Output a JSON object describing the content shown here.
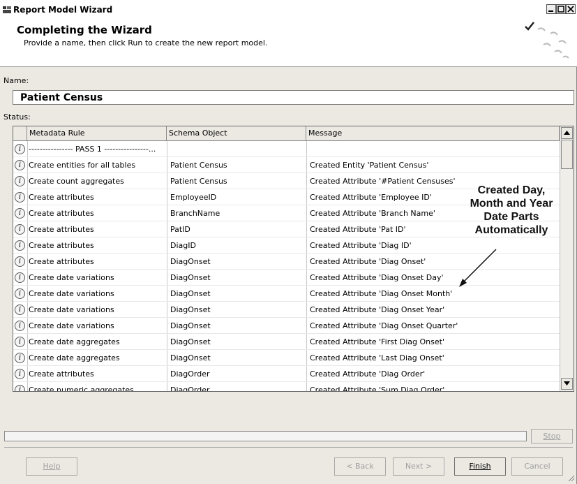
{
  "window": {
    "title": "Report Model Wizard"
  },
  "header": {
    "title": "Completing the Wizard",
    "subtitle": "Provide a name, then click Run to create the new report model."
  },
  "name": {
    "label": "Name:",
    "value": "Patient Census"
  },
  "status": {
    "label": "Status:"
  },
  "grid": {
    "columns": [
      "Metadata Rule",
      "Schema Object",
      "Message"
    ],
    "rows": [
      {
        "rule": "---------------- PASS 1 ----------------...",
        "object": "",
        "message": ""
      },
      {
        "rule": "Create entities for all tables",
        "object": "Patient Census",
        "message": "Created Entity 'Patient Census'"
      },
      {
        "rule": "Create count aggregates",
        "object": "Patient Census",
        "message": "Created Attribute '#Patient Censuses'"
      },
      {
        "rule": "Create attributes",
        "object": "EmployeeID",
        "message": "Created Attribute 'Employee ID'"
      },
      {
        "rule": "Create attributes",
        "object": "BranchName",
        "message": "Created Attribute 'Branch Name'"
      },
      {
        "rule": "Create attributes",
        "object": "PatID",
        "message": "Created Attribute 'Pat ID'"
      },
      {
        "rule": "Create attributes",
        "object": "DiagID",
        "message": "Created Attribute 'Diag ID'"
      },
      {
        "rule": "Create attributes",
        "object": "DiagOnset",
        "message": "Created Attribute 'Diag Onset'"
      },
      {
        "rule": "Create date variations",
        "object": "DiagOnset",
        "message": "Created Attribute 'Diag Onset Day'"
      },
      {
        "rule": "Create date variations",
        "object": "DiagOnset",
        "message": "Created Attribute 'Diag Onset Month'"
      },
      {
        "rule": "Create date variations",
        "object": "DiagOnset",
        "message": "Created Attribute 'Diag Onset Year'"
      },
      {
        "rule": "Create date variations",
        "object": "DiagOnset",
        "message": "Created Attribute 'Diag Onset Quarter'"
      },
      {
        "rule": "Create date aggregates",
        "object": "DiagOnset",
        "message": "Created Attribute 'First Diag Onset'"
      },
      {
        "rule": "Create date aggregates",
        "object": "DiagOnset",
        "message": "Created Attribute 'Last Diag Onset'"
      },
      {
        "rule": "Create attributes",
        "object": "DiagOrder",
        "message": "Created Attribute 'Diag Order'"
      },
      {
        "rule": "Create numeric aggregates",
        "object": "DiagOrder",
        "message": "Created Attribute 'Sum Diag Order'"
      }
    ]
  },
  "callout": {
    "lines": [
      "Created Day,",
      "Month and Year",
      "Date Parts",
      "Automatically"
    ]
  },
  "buttons": {
    "stop": "Stop",
    "help": "Help",
    "back": "< Back",
    "next": "Next >",
    "finish": "Finish",
    "cancel": "Cancel"
  },
  "icons": {
    "row": "info-icon"
  }
}
